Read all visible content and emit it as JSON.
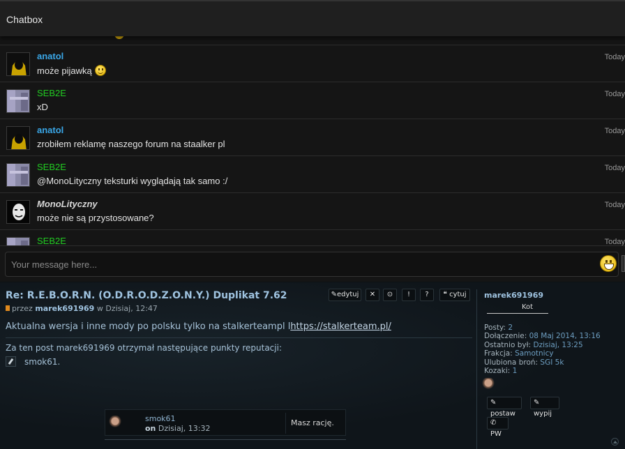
{
  "chatbox": {
    "title": "Chatbox",
    "input_placeholder": "Your message here...",
    "messages": [
      {
        "user": "anatol",
        "text": "może pijawką",
        "time": "Today",
        "color": "#3aa7e8",
        "italic": false,
        "emoji": true
      },
      {
        "user": "SEB2E",
        "text": "xD",
        "time": "Today",
        "color": "#22cc22",
        "italic": false,
        "emoji": false
      },
      {
        "user": "anatol",
        "text": "zrobiłem reklamę naszego forum na staalker pl",
        "time": "Today",
        "color": "#3aa7e8",
        "italic": false,
        "emoji": false
      },
      {
        "user": "SEB2E",
        "text": "@MonoLityczny teksturki wyglądają tak samo :/",
        "time": "Today",
        "color": "#22cc22",
        "italic": false,
        "emoji": false
      },
      {
        "user": "MonoLityczny",
        "text": "może nie są przystosowane?",
        "time": "Today",
        "color": "#d8d8d8",
        "italic": true,
        "emoji": false
      },
      {
        "user": "SEB2E",
        "text": "",
        "time": "Today",
        "color": "#22cc22",
        "italic": false,
        "emoji": false
      }
    ]
  },
  "post": {
    "title": "Re: R.E.B.O.R.N. (O.D.R.O.D.Z.O.N.Y.) Duplikat 7.62",
    "meta_prefix": "przez",
    "author": "marek691969",
    "meta_suffix": "w Dzisiaj, 12:47",
    "body_text": "Aktualna wersja i inne mody po polsku tylko na stalkerteampl l",
    "body_link": "https://stalkerteam.pl/",
    "rep_heading": "Za ten post marek691969 otrzymał następujące punkty reputacji:",
    "rep_user": "smok61.",
    "tools": {
      "edit": "edytuj",
      "delete": "✕",
      "report": "⊙",
      "warn": "!",
      "info": "?",
      "quote": "cytuj"
    }
  },
  "profile": {
    "username": "marek691969",
    "rank": "Kot",
    "rows": [
      {
        "label": "Posty:",
        "value": "2"
      },
      {
        "label": "Dołączenie:",
        "value": "08 Maj 2014, 13:16"
      },
      {
        "label": "Ostatnio był:",
        "value": "Dzisiaj, 13:25"
      },
      {
        "label": "Frakcja:",
        "value": "Samotnicy"
      },
      {
        "label": "Ulubiona broń:",
        "value": "SGI 5k"
      },
      {
        "label": "Kozaki:",
        "value": "1"
      }
    ],
    "buttons": {
      "postaw": "postaw",
      "wypij": "wypij",
      "pw": "PW"
    }
  },
  "reply": {
    "user": "smok61",
    "date_prefix": "on",
    "date": "Dzisiaj, 13:32",
    "text": "Masz rację."
  }
}
